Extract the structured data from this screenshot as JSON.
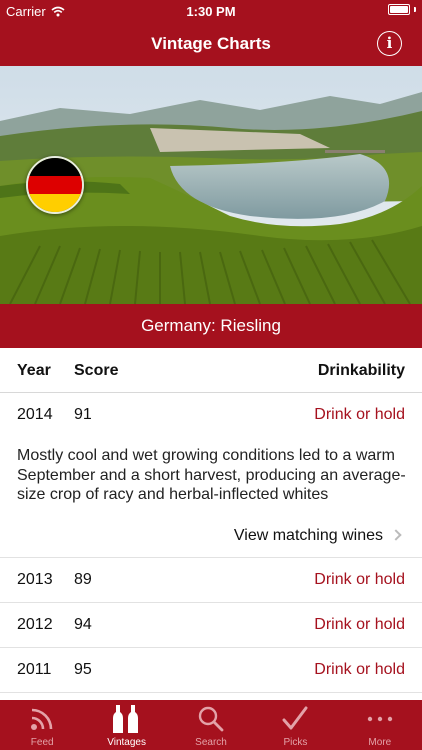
{
  "status_bar": {
    "carrier": "Carrier",
    "time": "1:30 PM"
  },
  "nav": {
    "title": "Vintage Charts",
    "info_icon": "info-icon"
  },
  "region": {
    "title": "Germany: Riesling",
    "flag_colors": [
      "#000000",
      "#dd0000",
      "#ffce00"
    ]
  },
  "table": {
    "headers": {
      "year": "Year",
      "score": "Score",
      "drinkability": "Drinkability"
    },
    "featured": {
      "year": "2014",
      "score": "91",
      "drinkability": "Drink or hold",
      "description": "Mostly cool and wet growing conditions led to a warm September and a short harvest, producing an average-size crop of racy and herbal-inflected whites",
      "link_label": "View matching wines"
    },
    "rows": [
      {
        "year": "2013",
        "score": "89",
        "drinkability": "Drink or hold"
      },
      {
        "year": "2012",
        "score": "94",
        "drinkability": "Drink or hold"
      },
      {
        "year": "2011",
        "score": "95",
        "drinkability": "Drink or hold"
      }
    ]
  },
  "tabs": [
    {
      "label": "Feed",
      "icon": "feed-icon",
      "active": false
    },
    {
      "label": "Vintages",
      "icon": "bottles-icon",
      "active": true
    },
    {
      "label": "Search",
      "icon": "search-icon",
      "active": false
    },
    {
      "label": "Picks",
      "icon": "checkmark-icon",
      "active": false
    },
    {
      "label": "More",
      "icon": "more-icon",
      "active": false
    }
  ],
  "colors": {
    "brand": "#a5111e",
    "drink_text": "#a5111e"
  }
}
